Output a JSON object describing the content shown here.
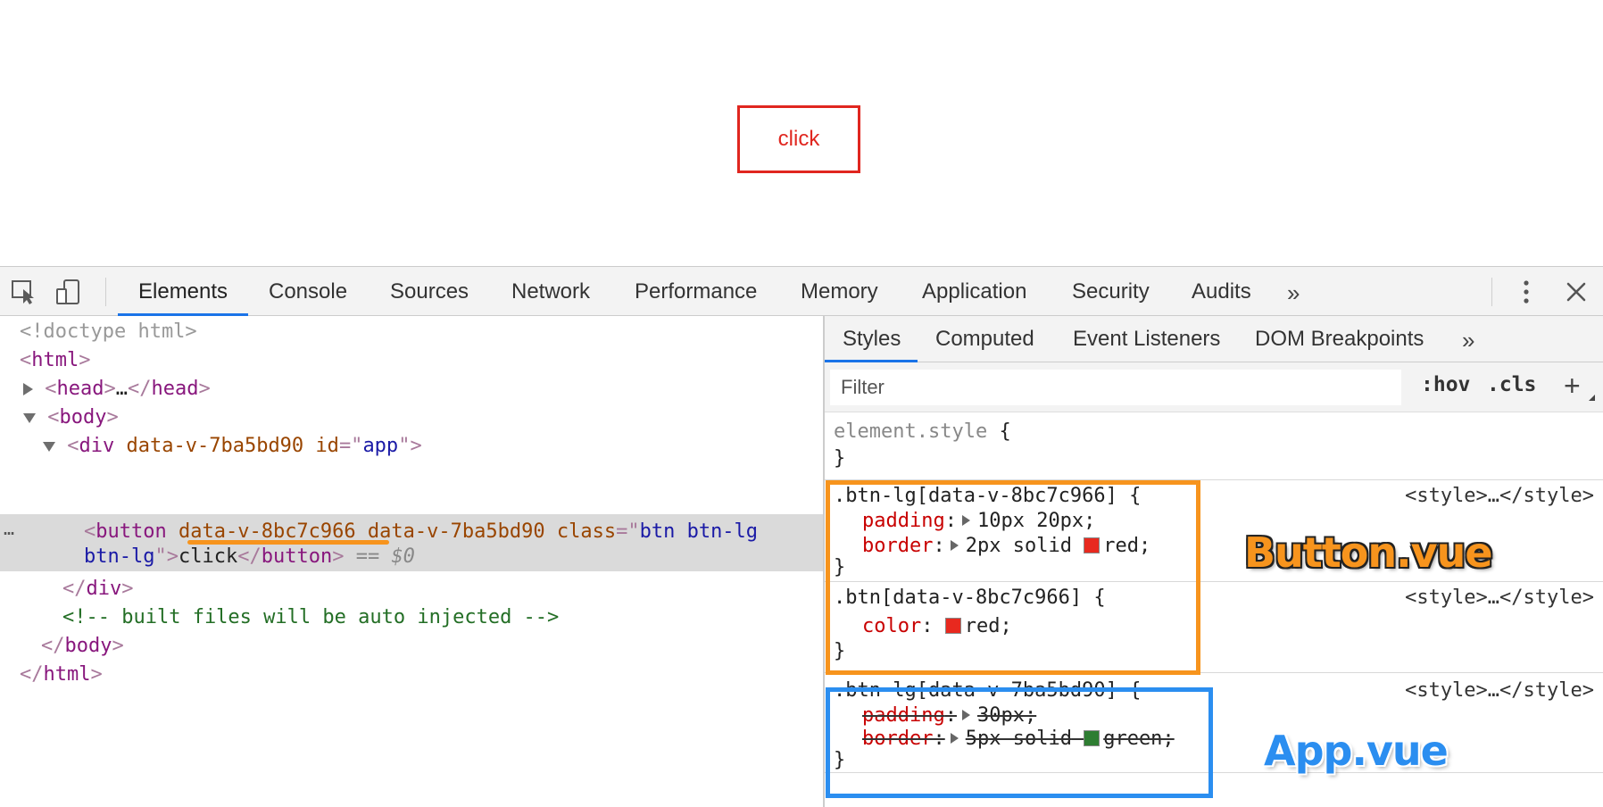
{
  "page": {
    "button_label": "click"
  },
  "devtools": {
    "tabs": [
      "Elements",
      "Console",
      "Sources",
      "Network",
      "Performance",
      "Memory",
      "Application",
      "Security",
      "Audits"
    ],
    "more_tabs": "»",
    "icons": {
      "inspect": "inspect-element-icon",
      "device": "device-toolbar-icon",
      "more_tabs": "double-chevron-right-icon",
      "menu": "kebab-menu-icon",
      "close": "close-icon"
    }
  },
  "elements": {
    "selected_ellipsis": "…",
    "lines": {
      "doctype": "<!doctype html>",
      "html_open_lt": "<",
      "html_name": "html",
      "gt": ">",
      "head_lt": "<",
      "head_name": "head",
      "head_ellipsis": "…",
      "head_close_lt": "</",
      "head_close_name": "head",
      "body_name": "body",
      "div_name": "div",
      "div_attr1": "data-v-7ba5bd90",
      "div_attr2": "id",
      "div_val2": "app",
      "button_name": "button",
      "button_attr1": "data-v-8bc7c966",
      "button_attr2": "data-v-7ba5bd90",
      "button_attr3": "class",
      "button_val3_a": "btn btn-lg",
      "button_val3_b": "btn-lg",
      "button_text": "click",
      "button_close": "button",
      "dollar": "== $0",
      "div_close": "div",
      "comment": "<!-- built files will be auto injected -->",
      "body_close": "body",
      "html_close": "html"
    }
  },
  "styles": {
    "tabs": [
      "Styles",
      "Computed",
      "Event Listeners",
      "DOM Breakpoints"
    ],
    "more": "»",
    "filter_placeholder": "Filter",
    "hov": ":hov",
    "cls": ".cls",
    "add": "+",
    "element_style_selector": "element.style",
    "open_brace": "{",
    "close_brace": "}",
    "source": "<style>…</style>",
    "rules": [
      {
        "selector": ".btn-lg[data-v-8bc7c966]",
        "props": [
          {
            "name": "padding",
            "value": "10px 20px;",
            "struck": false
          },
          {
            "name": "border",
            "value_pre": "2px solid",
            "swatch_color": "#e8291f",
            "value_post": "red;",
            "struck": false
          }
        ]
      },
      {
        "selector": ".btn[data-v-8bc7c966]",
        "props": [
          {
            "name": "color",
            "swatch_color": "#e8291f",
            "value_post": "red;",
            "struck": false
          }
        ]
      },
      {
        "selector": ".btn-lg[data-v-7ba5bd90]",
        "props": [
          {
            "name": "padding",
            "value": "30px;",
            "struck": true
          },
          {
            "name": "border",
            "value_pre": "5px solid",
            "swatch_color": "#2e7d32",
            "value_post": "green;",
            "struck": true
          }
        ]
      }
    ]
  },
  "annotations": {
    "button_vue": "Button.vue",
    "app_vue": "App.vue",
    "colors": {
      "orange": "#f7941d",
      "blue": "#2b8ef0"
    }
  }
}
